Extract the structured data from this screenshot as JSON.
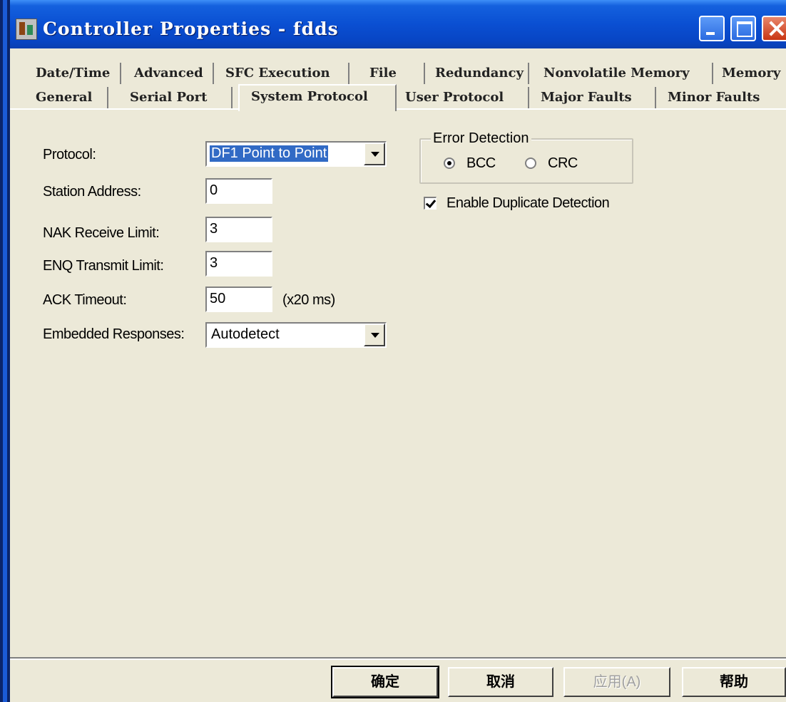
{
  "window": {
    "title": "Controller Properties - fdds",
    "icon": "controller-icon"
  },
  "tabs": {
    "row1": [
      "Date/Time",
      "Advanced",
      "SFC Execution",
      "File",
      "Redundancy",
      "Nonvolatile Memory",
      "Memory"
    ],
    "row2": [
      "General",
      "Serial Port",
      "System Protocol",
      "User Protocol",
      "Major Faults",
      "Minor Faults"
    ],
    "active": "System Protocol"
  },
  "form": {
    "protocol_label": "Protocol:",
    "protocol_value": "DF1 Point to Point",
    "station_label": "Station Address:",
    "station_value": "0",
    "nak_label": "NAK Receive Limit:",
    "nak_value": "3",
    "enq_label": "ENQ Transmit Limit:",
    "enq_value": "3",
    "ack_label": "ACK Timeout:",
    "ack_value": "50",
    "ack_unit": "(x20 ms)",
    "embedded_label": "Embedded Responses:",
    "embedded_value": "Autodetect"
  },
  "error_detection": {
    "title": "Error Detection",
    "options": [
      "BCC",
      "CRC"
    ],
    "selected": "BCC"
  },
  "duplicate": {
    "label": "Enable Duplicate Detection",
    "checked": true
  },
  "buttons": {
    "ok": "确定",
    "cancel": "取消",
    "apply": "应用(A)",
    "help": "帮助"
  }
}
